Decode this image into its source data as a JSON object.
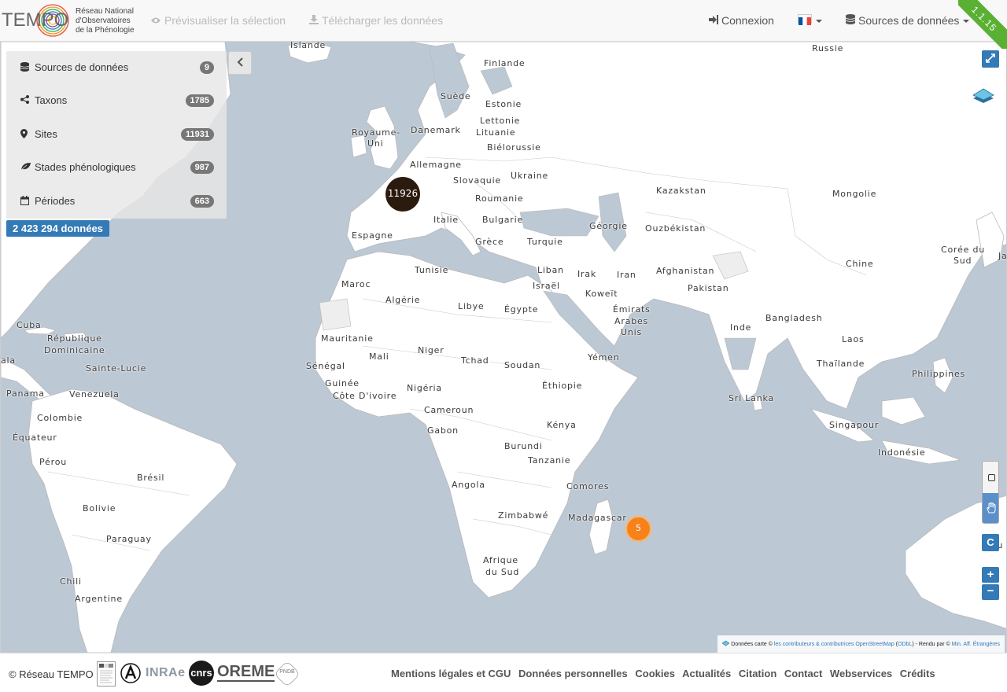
{
  "navbar": {
    "logo": {
      "word": "TEMPO",
      "subtitle_lines": [
        "Réseau National",
        "d'Observatoires",
        "de la Phénologie"
      ]
    },
    "preview_label": "Prévisualiser la sélection",
    "download_label": "Télécharger les données",
    "login_label": "Connexion",
    "language_flag": "FR",
    "sources_label": "Sources de données",
    "version": "1.1.15"
  },
  "filters": [
    {
      "icon": "database-icon",
      "label": "Sources de données",
      "count": "9"
    },
    {
      "icon": "share-icon",
      "label": "Taxons",
      "count": "1785"
    },
    {
      "icon": "map-marker-icon",
      "label": "Sites",
      "count": "11931"
    },
    {
      "icon": "leaf-icon",
      "label": "Stades phénologiques",
      "count": "987"
    },
    {
      "icon": "calendar-icon",
      "label": "Périodes",
      "count": "663"
    }
  ],
  "total_label": "2 423 294 données",
  "map": {
    "clusters": [
      {
        "count": "11926",
        "color": "#2b1a0e"
      },
      {
        "count": "5",
        "color": "#f7821b"
      }
    ],
    "labels": {
      "islande": "Islande",
      "finlande": "Finlande",
      "russie": "Russie",
      "suede": "Suède",
      "estonie": "Estonie",
      "lettonie": "Lettonie",
      "lituanie": "Lituanie",
      "danemark": "Danemark",
      "royaume_uni_1": "Royaume-",
      "royaume_uni_2": "Uni",
      "bielorussie": "Biélorussie",
      "allemagne": "Allemagne",
      "ukraine": "Ukraine",
      "slovaquie": "Slovaquie",
      "kazakstan": "Kazakstan",
      "mongolie": "Mongolie",
      "roumanie": "Roumanie",
      "italie": "Italie",
      "bulgarie": "Bulgarie",
      "georgie": "Géorgie",
      "ouzbekistan": "Ouzbékistan",
      "espagne": "Espagne",
      "grece": "Grèce",
      "turquie": "Turquie",
      "coree_1": "Corée du",
      "coree_2": "Sud",
      "japon": "Ja",
      "chine": "Chine",
      "maroc": "Maroc",
      "tunisie": "Tunisie",
      "liban": "Liban",
      "israel": "Israël",
      "irak": "Irak",
      "iran": "Iran",
      "afghanistan": "Afghanistan",
      "pakistan": "Pakistan",
      "algerie": "Algérie",
      "libye": "Libye",
      "egypte": "Égypte",
      "koweit": "Koweït",
      "emirats_1": "Émirats",
      "emirats_2": "Arabes",
      "emirats_3": "Unis",
      "bangladesh": "Bangladesh",
      "inde": "Inde",
      "cuba": "Cuba",
      "mauritanie": "Mauritanie",
      "laos": "Laos",
      "rep_dom_1": "République",
      "rep_dom_2": "Dominicaine",
      "mali": "Mali",
      "niger": "Niger",
      "tchad": "Tchad",
      "soudan": "Soudan",
      "yemen": "Yémen",
      "thailande": "Thaïlande",
      "philippines": "Philippines",
      "ala": "ala",
      "sainte_lucie": "Sainte-Lucie",
      "senegal": "Sénégal",
      "guinee": "Guinée",
      "nigeria": "Nigéria",
      "ethiopie": "Éthiopie",
      "panama": "Panama",
      "venezuela": "Venezuela",
      "cote_divoire": "Côte D'ivoire",
      "sri_lanka": "Sri Lanka",
      "cameroun": "Cameroun",
      "colombie": "Colombie",
      "equateur": "Équateur",
      "gabon": "Gabon",
      "kenya": "Kénya",
      "singapour": "Singapour",
      "burundi": "Burundi",
      "indonesie": "Indonésie",
      "tanzanie": "Tanzanie",
      "perou": "Pérou",
      "bresil": "Brésil",
      "angola": "Angola",
      "comores": "Comores",
      "bolivie": "Bolivie",
      "zimbabwe": "Zimbabwé",
      "madagascar": "Madagascar",
      "paraguay": "Paraguay",
      "australie": "Au",
      "afrique_sud_1": "Afrique",
      "afrique_sud_2": "du Sud",
      "chili": "Chili",
      "argentine": "Argentine"
    },
    "controls": {
      "c_label": "C",
      "zoom_in": "+",
      "zoom_out": "−"
    },
    "attribution": {
      "prefix": "Données carte ©",
      "osm_link": "les contributeurs & contributrices OpenStreetMap",
      "odbl": "ODbL",
      "middle": ") - Rendu par ©",
      "renderer_link": "Min. Aff. Étrangères"
    }
  },
  "footer": {
    "copyright": "© Réseau TEMPO",
    "partners": [
      "inrae",
      "cnrs",
      "oreme",
      "pndb"
    ],
    "inrae_text": "INRAe",
    "cnrs_text": "cnrs",
    "oreme_text": "OREME",
    "pndb_text": "PNDB",
    "links": [
      "Mentions légales et CGU",
      "Données personnelles",
      "Cookies",
      "Actualités",
      "Citation",
      "Contact",
      "Webservices",
      "Crédits"
    ]
  }
}
